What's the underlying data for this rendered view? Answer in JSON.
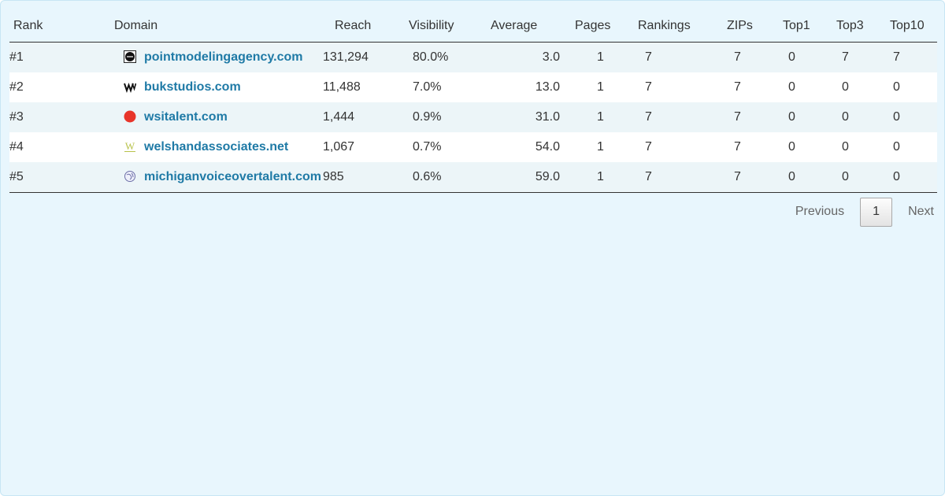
{
  "headers": {
    "rank": "Rank",
    "domain": "Domain",
    "reach": "Reach",
    "visibility": "Visibility",
    "average": "Average",
    "pages": "Pages",
    "rankings": "Rankings",
    "zips": "ZIPs",
    "top1": "Top1",
    "top3": "Top3",
    "top10": "Top10"
  },
  "rows": [
    {
      "rank": "#1",
      "domain": "pointmodelingagency.com",
      "icon": "point-logo-icon",
      "reach": "131,294",
      "visibility": "80.0%",
      "average": "3.0",
      "pages": "1",
      "rankings": "7",
      "zips": "7",
      "top1": "0",
      "top3": "7",
      "top10": "7"
    },
    {
      "rank": "#2",
      "domain": "bukstudios.com",
      "icon": "wix-logo-icon",
      "reach": "11,488",
      "visibility": "7.0%",
      "average": "13.0",
      "pages": "1",
      "rankings": "7",
      "zips": "7",
      "top1": "0",
      "top3": "0",
      "top10": "0"
    },
    {
      "rank": "#3",
      "domain": "wsitalent.com",
      "icon": "red-circle-icon",
      "reach": "1,444",
      "visibility": "0.9%",
      "average": "31.0",
      "pages": "1",
      "rankings": "7",
      "zips": "7",
      "top1": "0",
      "top3": "0",
      "top10": "0"
    },
    {
      "rank": "#4",
      "domain": "welshandassociates.net",
      "icon": "w-logo-icon",
      "reach": "1,067",
      "visibility": "0.7%",
      "average": "54.0",
      "pages": "1",
      "rankings": "7",
      "zips": "7",
      "top1": "0",
      "top3": "0",
      "top10": "0"
    },
    {
      "rank": "#5",
      "domain": "michiganvoiceovertalent.com",
      "icon": "globe-icon",
      "reach": "985",
      "visibility": "0.6%",
      "average": "59.0",
      "pages": "1",
      "rankings": "7",
      "zips": "7",
      "top1": "0",
      "top3": "0",
      "top10": "0"
    }
  ],
  "pagination": {
    "previous": "Previous",
    "current": "1",
    "next": "Next"
  },
  "colors": {
    "panel_bg": "#e8f6fd",
    "link": "#1f7aa6",
    "row_stripe": "#ecf5f8"
  }
}
